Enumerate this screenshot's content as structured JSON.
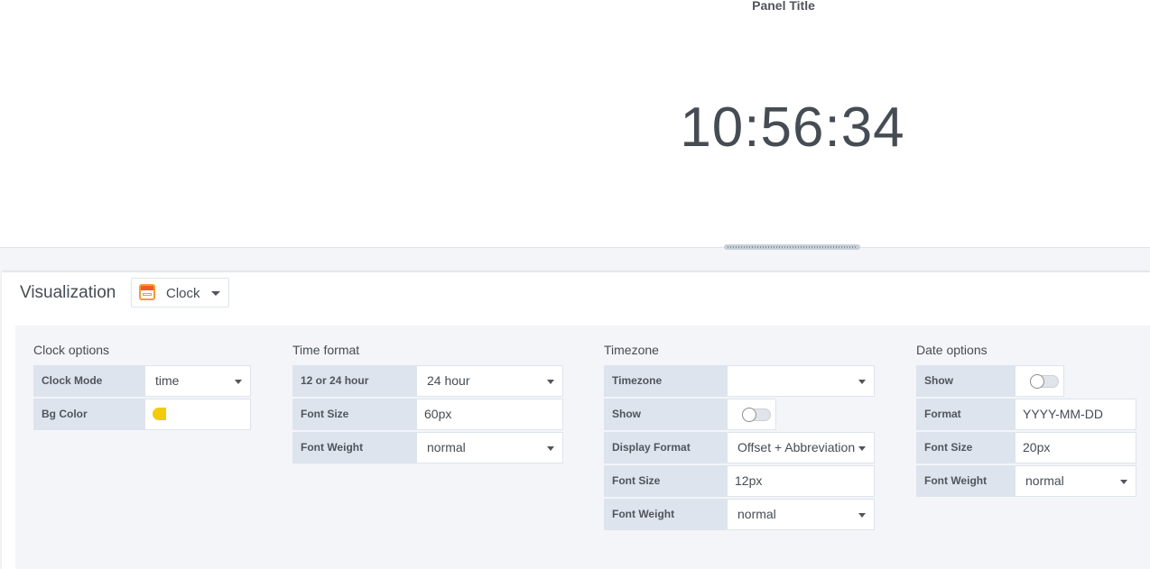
{
  "panel": {
    "title": "Panel Title",
    "time": "10:56:34"
  },
  "editor": {
    "visualization_label": "Visualization",
    "visualization_value": "Clock",
    "visualization_icon": "clock-panel-icon"
  },
  "clock_options": {
    "title": "Clock options",
    "mode_label": "Clock Mode",
    "mode_value": "time",
    "bg_color_label": "Bg Color",
    "bg_color_value": "#F2CC0C"
  },
  "time_format": {
    "title": "Time format",
    "hour_label": "12 or 24 hour",
    "hour_value": "24 hour",
    "font_size_label": "Font Size",
    "font_size_value": "60px",
    "font_weight_label": "Font Weight",
    "font_weight_value": "normal"
  },
  "timezone": {
    "title": "Timezone",
    "timezone_label": "Timezone",
    "timezone_value": "",
    "show_label": "Show",
    "show_value": false,
    "display_format_label": "Display Format",
    "display_format_value": "Offset + Abbreviation",
    "font_size_label": "Font Size",
    "font_size_value": "12px",
    "font_weight_label": "Font Weight",
    "font_weight_value": "normal"
  },
  "date_options": {
    "title": "Date options",
    "show_label": "Show",
    "show_value": false,
    "format_label": "Format",
    "format_value": "YYYY-MM-DD",
    "font_size_label": "Font Size",
    "font_size_value": "20px",
    "font_weight_label": "Font Weight",
    "font_weight_value": "normal"
  }
}
